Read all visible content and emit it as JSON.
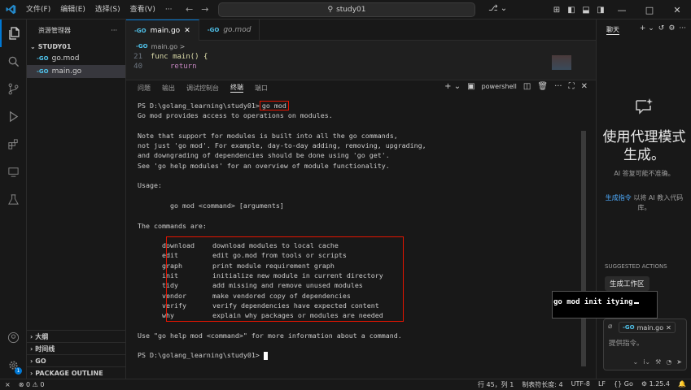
{
  "titlebar": {
    "menus": [
      "文件(F)",
      "编辑(E)",
      "选择(S)",
      "查看(V)",
      "···"
    ],
    "search": "study01"
  },
  "sidebar": {
    "title": "资源管理器",
    "folder": "STUDY01",
    "files": [
      "go.mod",
      "main.go"
    ],
    "bottom_sections": [
      "大纲",
      "时间线",
      "GO",
      "PACKAGE OUTLINE"
    ],
    "go_badge": "-GO"
  },
  "editor": {
    "tabs": [
      "main.go",
      "go.mod"
    ],
    "tab_badge": "-GO",
    "breadcrumb": "main.go >",
    "lines": [
      {
        "n": "21",
        "text": "func main() {"
      },
      {
        "n": "40",
        "text": "return"
      },
      {
        "n": "46",
        "text": "}"
      }
    ]
  },
  "panel": {
    "tabs": [
      "问题",
      "输出",
      "调试控制台",
      "终端",
      "端口"
    ],
    "active": "终端",
    "shell": "powershell"
  },
  "terminal": {
    "prompt": "PS D:\\golang_learning\\study01>",
    "command": "go mod",
    "lines_before": [
      "Go mod provides access to operations on modules.",
      "",
      "Note that support for modules is built into all the go commands,",
      "not just 'go mod'. For example, day-to-day adding, removing, upgrading,",
      "and downgrading of dependencies should be done using 'go get'.",
      "See 'go help modules' for an overview of module functionality.",
      "",
      "Usage:",
      "",
      "        go mod <command> [arguments]",
      "",
      "The commands are:",
      ""
    ],
    "commands": [
      [
        "download",
        "download modules to local cache"
      ],
      [
        "edit",
        "edit go.mod from tools or scripts"
      ],
      [
        "graph",
        "print module requirement graph"
      ],
      [
        "init",
        "initialize new module in current directory"
      ],
      [
        "tidy",
        "add missing and remove unused modules"
      ],
      [
        "vendor",
        "make vendored copy of dependencies"
      ],
      [
        "verify",
        "verify dependencies have expected content"
      ],
      [
        "why",
        "explain why packages or modules are needed"
      ]
    ],
    "help": "Use \"go help mod <command>\" for more information about a command.",
    "final_prompt": "PS D:\\golang_learning\\study01>"
  },
  "chat": {
    "tab": "聊天",
    "title": "使用代理模式生成。",
    "subtitle": "AI 答复可能不准确。",
    "link": "生成指令",
    "link_rest": "以将 AI 教入代码库。",
    "suggested": "SUGGESTED ACTIONS",
    "action": "生成工作区",
    "chip": "main.go",
    "placeholder": "提供指令。"
  },
  "overlay": {
    "text": "go mod init itying"
  },
  "statusbar": {
    "errors": "0",
    "warnings": "0",
    "position": "行 45，列 1",
    "tabsize": "制表符长度: 4",
    "encoding": "UTF-8",
    "eol": "LF",
    "lang": "Go",
    "version": "1.25.4"
  }
}
